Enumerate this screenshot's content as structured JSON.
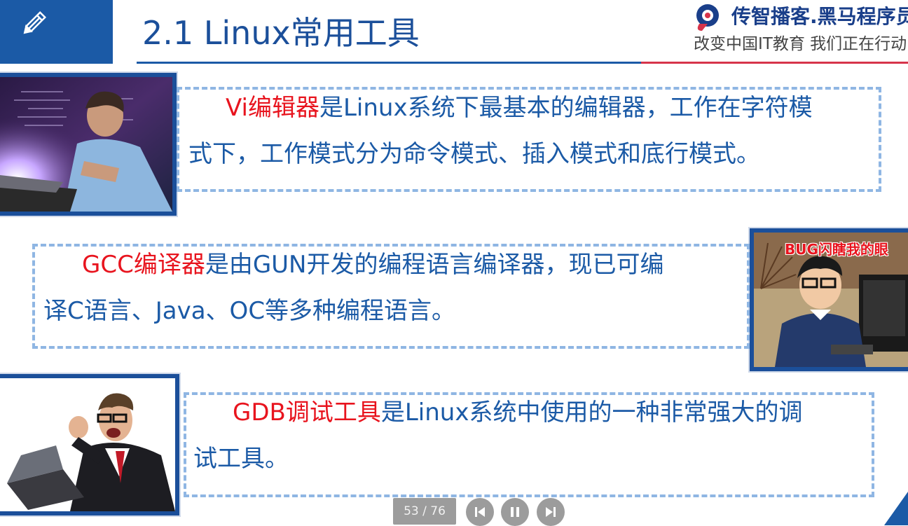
{
  "slide": {
    "title": "2.1 Linux常用工具"
  },
  "brand": {
    "name": "传智播客.黑马程序员",
    "slogan": "改变中国IT教育 我们正在行动"
  },
  "items": [
    {
      "highlight": "Vi编辑器",
      "line1": "是Linux系统下最基本的编辑器，工作在字符模",
      "line2": "式下，工作模式分为命令模式、插入模式和底行模式。"
    },
    {
      "highlight": "GCC编译器",
      "line1": "是由GUN开发的编程语言编译器，现已可编",
      "line2": "译C语言、Java、OC等多种编程语言。"
    },
    {
      "highlight": "GDB调试工具",
      "line1": "是Linux系统中使用的一种非常强大的调",
      "line2": "试工具。"
    }
  ],
  "images": {
    "meme_caption": "BUG闪瞎我的眼"
  },
  "controls": {
    "page_indicator": "53 / 76",
    "prev_icon": "skip-previous-icon",
    "pause_icon": "pause-icon",
    "next_icon": "skip-next-icon"
  },
  "colors": {
    "primary_blue": "#1b5aa6",
    "highlight_red": "#e8141e",
    "dashed_border": "#8fb6e3",
    "accent_red": "#d6344a"
  }
}
